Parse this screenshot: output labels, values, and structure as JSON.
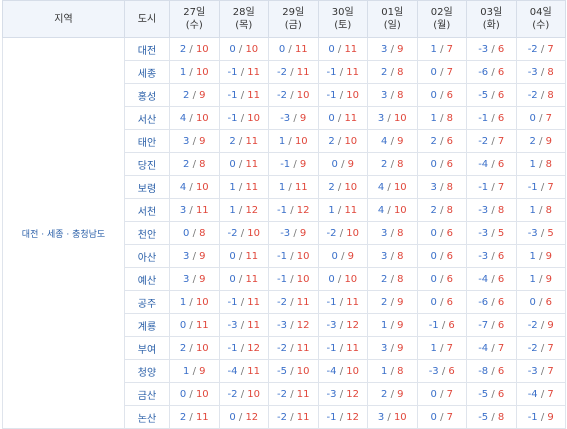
{
  "header": {
    "region_label": "지역",
    "city_label": "도시",
    "dates": [
      {
        "day": "27일",
        "weekday": "(수)"
      },
      {
        "day": "28일",
        "weekday": "(목)"
      },
      {
        "day": "29일",
        "weekday": "(금)"
      },
      {
        "day": "30일",
        "weekday": "(토)"
      },
      {
        "day": "01일",
        "weekday": "(일)"
      },
      {
        "day": "02일",
        "weekday": "(월)"
      },
      {
        "day": "03일",
        "weekday": "(화)"
      },
      {
        "day": "04일",
        "weekday": "(수)"
      }
    ]
  },
  "region": "대전 · 세종 · 충청남도",
  "separator": "/",
  "colors": {
    "low": "#3a6fc9",
    "high": "#e0463a",
    "header_bg": "#f1f5fb"
  },
  "rows": [
    {
      "city": "대전",
      "temps": [
        [
          "2",
          "10"
        ],
        [
          "0",
          "10"
        ],
        [
          "0",
          "11"
        ],
        [
          "0",
          "11"
        ],
        [
          "3",
          "9"
        ],
        [
          "1",
          "7"
        ],
        [
          "-3",
          "6"
        ],
        [
          "-2",
          "7"
        ]
      ]
    },
    {
      "city": "세종",
      "temps": [
        [
          "1",
          "10"
        ],
        [
          "-1",
          "11"
        ],
        [
          "-2",
          "11"
        ],
        [
          "-1",
          "11"
        ],
        [
          "2",
          "8"
        ],
        [
          "0",
          "7"
        ],
        [
          "-6",
          "6"
        ],
        [
          "-3",
          "8"
        ]
      ]
    },
    {
      "city": "홍성",
      "temps": [
        [
          "2",
          "9"
        ],
        [
          "-1",
          "11"
        ],
        [
          "-2",
          "10"
        ],
        [
          "-1",
          "10"
        ],
        [
          "3",
          "8"
        ],
        [
          "0",
          "6"
        ],
        [
          "-5",
          "6"
        ],
        [
          "-2",
          "8"
        ]
      ]
    },
    {
      "city": "서산",
      "temps": [
        [
          "4",
          "10"
        ],
        [
          "-1",
          "10"
        ],
        [
          "-3",
          "9"
        ],
        [
          "0",
          "11"
        ],
        [
          "3",
          "10"
        ],
        [
          "1",
          "8"
        ],
        [
          "-1",
          "6"
        ],
        [
          "0",
          "7"
        ]
      ]
    },
    {
      "city": "태안",
      "temps": [
        [
          "3",
          "9"
        ],
        [
          "2",
          "11"
        ],
        [
          "1",
          "10"
        ],
        [
          "2",
          "10"
        ],
        [
          "4",
          "9"
        ],
        [
          "2",
          "6"
        ],
        [
          "-2",
          "7"
        ],
        [
          "2",
          "9"
        ]
      ]
    },
    {
      "city": "당진",
      "temps": [
        [
          "2",
          "8"
        ],
        [
          "0",
          "11"
        ],
        [
          "-1",
          "9"
        ],
        [
          "0",
          "9"
        ],
        [
          "2",
          "8"
        ],
        [
          "0",
          "6"
        ],
        [
          "-4",
          "6"
        ],
        [
          "1",
          "8"
        ]
      ]
    },
    {
      "city": "보령",
      "temps": [
        [
          "4",
          "10"
        ],
        [
          "1",
          "11"
        ],
        [
          "1",
          "11"
        ],
        [
          "2",
          "10"
        ],
        [
          "4",
          "10"
        ],
        [
          "3",
          "8"
        ],
        [
          "-1",
          "7"
        ],
        [
          "-1",
          "7"
        ]
      ]
    },
    {
      "city": "서천",
      "temps": [
        [
          "3",
          "11"
        ],
        [
          "1",
          "12"
        ],
        [
          "-1",
          "12"
        ],
        [
          "1",
          "11"
        ],
        [
          "4",
          "10"
        ],
        [
          "2",
          "8"
        ],
        [
          "-3",
          "8"
        ],
        [
          "1",
          "8"
        ]
      ]
    },
    {
      "city": "천안",
      "temps": [
        [
          "0",
          "8"
        ],
        [
          "-2",
          "10"
        ],
        [
          "-3",
          "9"
        ],
        [
          "-2",
          "10"
        ],
        [
          "3",
          "8"
        ],
        [
          "0",
          "6"
        ],
        [
          "-3",
          "5"
        ],
        [
          "-3",
          "5"
        ]
      ]
    },
    {
      "city": "아산",
      "temps": [
        [
          "3",
          "9"
        ],
        [
          "0",
          "11"
        ],
        [
          "-1",
          "10"
        ],
        [
          "0",
          "9"
        ],
        [
          "3",
          "8"
        ],
        [
          "0",
          "6"
        ],
        [
          "-3",
          "6"
        ],
        [
          "1",
          "9"
        ]
      ]
    },
    {
      "city": "예산",
      "temps": [
        [
          "3",
          "9"
        ],
        [
          "0",
          "11"
        ],
        [
          "-1",
          "10"
        ],
        [
          "0",
          "10"
        ],
        [
          "2",
          "8"
        ],
        [
          "0",
          "6"
        ],
        [
          "-4",
          "6"
        ],
        [
          "1",
          "9"
        ]
      ]
    },
    {
      "city": "공주",
      "temps": [
        [
          "1",
          "10"
        ],
        [
          "-1",
          "11"
        ],
        [
          "-2",
          "11"
        ],
        [
          "-1",
          "11"
        ],
        [
          "2",
          "9"
        ],
        [
          "0",
          "6"
        ],
        [
          "-6",
          "6"
        ],
        [
          "0",
          "6"
        ]
      ]
    },
    {
      "city": "계룡",
      "temps": [
        [
          "0",
          "11"
        ],
        [
          "-3",
          "11"
        ],
        [
          "-3",
          "12"
        ],
        [
          "-3",
          "12"
        ],
        [
          "1",
          "9"
        ],
        [
          "-1",
          "6"
        ],
        [
          "-7",
          "6"
        ],
        [
          "-2",
          "9"
        ]
      ]
    },
    {
      "city": "부여",
      "temps": [
        [
          "2",
          "10"
        ],
        [
          "-1",
          "12"
        ],
        [
          "-2",
          "11"
        ],
        [
          "-1",
          "11"
        ],
        [
          "3",
          "9"
        ],
        [
          "1",
          "7"
        ],
        [
          "-4",
          "7"
        ],
        [
          "-2",
          "7"
        ]
      ]
    },
    {
      "city": "청양",
      "temps": [
        [
          "1",
          "9"
        ],
        [
          "-4",
          "11"
        ],
        [
          "-5",
          "10"
        ],
        [
          "-4",
          "10"
        ],
        [
          "1",
          "8"
        ],
        [
          "-3",
          "6"
        ],
        [
          "-8",
          "6"
        ],
        [
          "-3",
          "7"
        ]
      ]
    },
    {
      "city": "금산",
      "temps": [
        [
          "0",
          "10"
        ],
        [
          "-2",
          "10"
        ],
        [
          "-2",
          "11"
        ],
        [
          "-3",
          "12"
        ],
        [
          "2",
          "9"
        ],
        [
          "0",
          "7"
        ],
        [
          "-5",
          "6"
        ],
        [
          "-4",
          "7"
        ]
      ]
    },
    {
      "city": "논산",
      "temps": [
        [
          "2",
          "11"
        ],
        [
          "0",
          "12"
        ],
        [
          "-2",
          "11"
        ],
        [
          "-1",
          "12"
        ],
        [
          "3",
          "10"
        ],
        [
          "0",
          "7"
        ],
        [
          "-5",
          "8"
        ],
        [
          "-1",
          "9"
        ]
      ]
    }
  ]
}
